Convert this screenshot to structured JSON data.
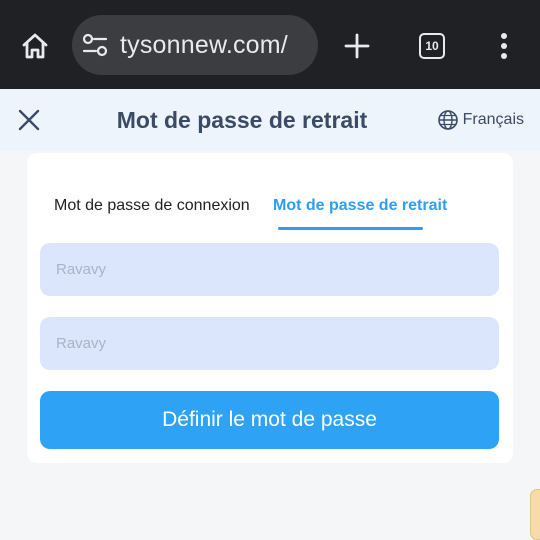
{
  "browser": {
    "url": "tysonnew.com/",
    "tab_count": "10",
    "icons": [
      "home-icon",
      "site-settings-icon",
      "new-tab-icon",
      "tab-switcher-icon",
      "more-menu-icon"
    ]
  },
  "header": {
    "title": "Mot de passe de retrait",
    "language": "Français",
    "icons": [
      "close-icon",
      "globe-icon"
    ]
  },
  "tabs": [
    {
      "label": "Mot de passe de connexion",
      "active": false
    },
    {
      "label": "Mot de passe de retrait",
      "active": true
    }
  ],
  "form": {
    "field1_placeholder": "Ravavy",
    "field2_placeholder": "Ravavy",
    "submit_label": "Définir le mot de passe"
  },
  "colors": {
    "accent": "#2ea3f5",
    "title": "#3b4a66",
    "field_bg": "#dbe6fd",
    "chrome_bg": "#202124"
  }
}
